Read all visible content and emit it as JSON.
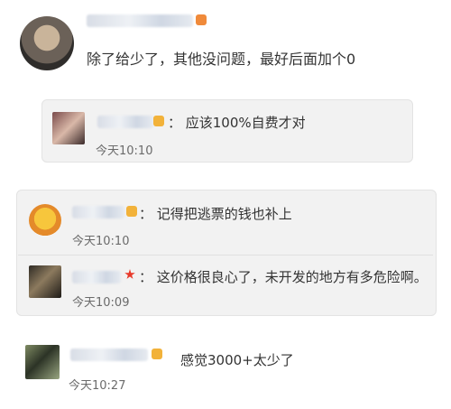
{
  "post": {
    "text": "除了给少了，其他没问题，最好后面加个0"
  },
  "replies": [
    {
      "text": "： 应该100%自费才对",
      "time": "今天10:10"
    },
    {
      "text": "： 记得把逃票的钱也补上",
      "time": "今天10:10"
    },
    {
      "text": "： 这价格很良心了，未开发的地方有多危险啊。",
      "time": "今天10:09"
    },
    {
      "text": "感觉3000+太少了",
      "time": "今天10:27"
    }
  ]
}
